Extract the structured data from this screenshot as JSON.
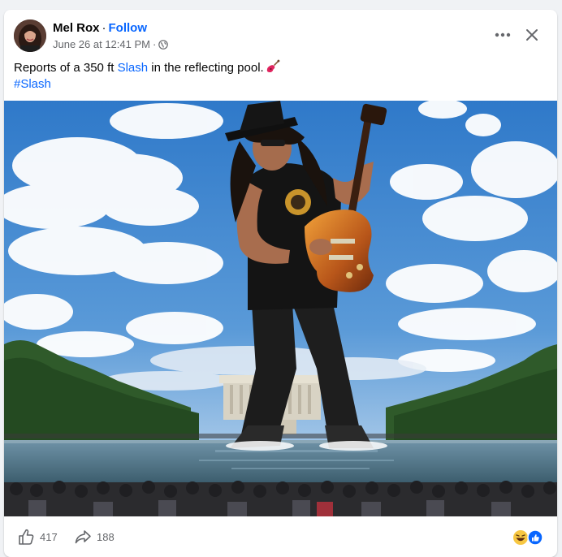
{
  "post": {
    "author": "Mel Rox",
    "separator": "·",
    "follow_label": "Follow",
    "timestamp": "June 26 at 12:41 PM",
    "meta_separator": "·",
    "audience_icon": "globe-icon",
    "text_before_link": "Reports of a 350 ft ",
    "text_link": "Slash",
    "text_after_link": " in the reflecting pool.",
    "text_emoji": "guitar-emoji",
    "hashtag": "#Slash"
  },
  "actions": {
    "like_icon": "thumbs-up-icon",
    "like_count": "417",
    "share_icon": "share-arrow-icon",
    "share_count": "188",
    "reaction_icons": [
      "laughing-face-icon",
      "like-reaction-icon"
    ]
  },
  "header_controls": {
    "more_icon": "more-options-icon",
    "close_icon": "close-icon"
  },
  "colors": {
    "link_blue": "#0866ff",
    "secondary_text": "#65676b",
    "background": "#f0f2f5"
  }
}
